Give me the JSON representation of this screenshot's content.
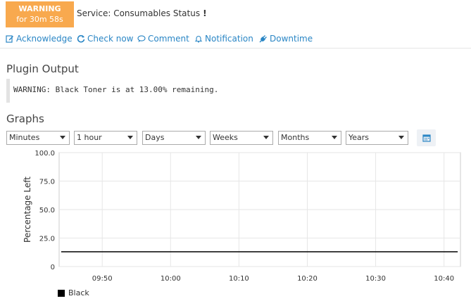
{
  "status": {
    "state": "WARNING",
    "duration": "for 30m 58s",
    "color": "#f8a94e"
  },
  "service": {
    "label": "Service: Consumables Status",
    "flag": "!"
  },
  "actions": [
    {
      "label": "Acknowledge",
      "icon": "edit-icon"
    },
    {
      "label": "Check now",
      "icon": "refresh-icon"
    },
    {
      "label": "Comment",
      "icon": "comment-icon"
    },
    {
      "label": "Notification",
      "icon": "bell-icon"
    },
    {
      "label": "Downtime",
      "icon": "plug-icon"
    }
  ],
  "accent_color": "#2a86c5",
  "plugin_output": {
    "heading": "Plugin Output",
    "text": "WARNING: Black Toner is at 13.00% remaining."
  },
  "graphs": {
    "heading": "Graphs",
    "selects": [
      "Minutes",
      "1 hour",
      "Days",
      "Weeks",
      "Months",
      "Years"
    ],
    "calendar_icon": "calendar-icon"
  },
  "chart_data": {
    "type": "line",
    "ylabel": "Percentage Left",
    "xlabel": "",
    "ylim": [
      0,
      100
    ],
    "yticks": [
      "100.0",
      "75.0",
      "50.0",
      "25.0",
      "0"
    ],
    "xticks": [
      "09:50",
      "10:00",
      "10:10",
      "10:20",
      "10:30",
      "10:40"
    ],
    "series": [
      {
        "name": "Black",
        "color": "#000000",
        "x_start": "09:44",
        "x_end": "10:42",
        "values": [
          13,
          13
        ]
      }
    ],
    "grid": true,
    "legend": "bottom-left"
  }
}
